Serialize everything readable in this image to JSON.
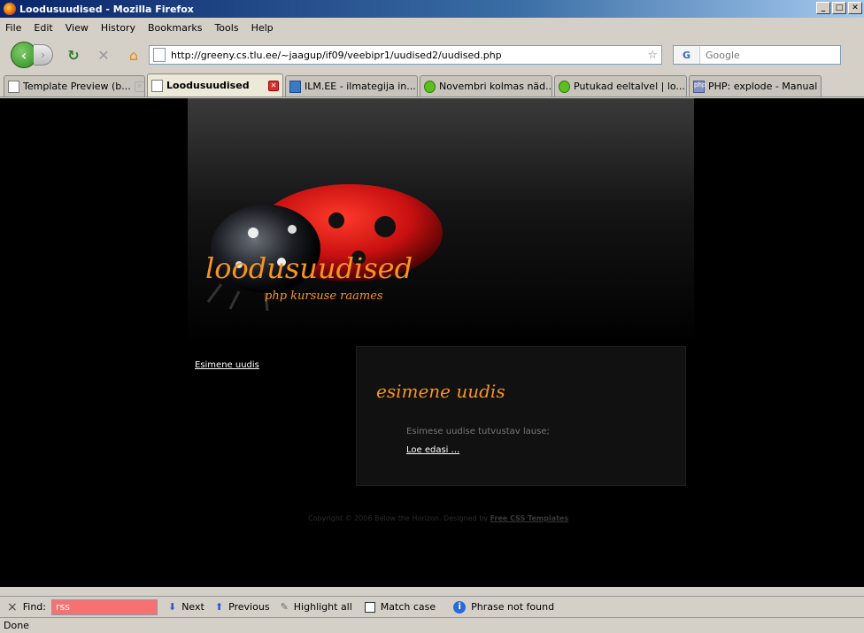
{
  "window": {
    "title": "Loodusuudised - Mozilla Firefox"
  },
  "menu": [
    "File",
    "Edit",
    "View",
    "History",
    "Bookmarks",
    "Tools",
    "Help"
  ],
  "nav": {
    "url": "http://greeny.cs.tlu.ee/~jaagup/if09/veebipr1/uudised2/uudised.php",
    "search_placeholder": "Google"
  },
  "tabs": [
    {
      "label": "Template Preview (b...",
      "icon": "page-icon"
    },
    {
      "label": "Loodusuudised",
      "icon": "page-icon",
      "active": true
    },
    {
      "label": "ILM.EE - ilmategija in...",
      "icon": "ilm-icon"
    },
    {
      "label": "Novembri kolmas näd...",
      "icon": "leaf-icon"
    },
    {
      "label": "Putukad eeltalvel | lo...",
      "icon": "leaf-icon"
    },
    {
      "label": "PHP: explode - Manual",
      "icon": "php-icon"
    }
  ],
  "page": {
    "site_title": "loodusuudised",
    "site_subtitle": "php kursuse raames",
    "sidebar_link": "Esimene uudis",
    "news": {
      "title": "esimene uudis",
      "text": "Esimese uudise tutvustav lause;",
      "read_more": "Loe edasi ..."
    },
    "copyright_text": "Copyright © 2006 Below the Horizon. Designed by",
    "copyright_link": "Free CSS Templates"
  },
  "find": {
    "close": "×",
    "label": "Find:",
    "value": "rss",
    "next": "Next",
    "previous": "Previous",
    "highlight": "Highlight all",
    "match_case": "Match case",
    "status": "Phrase not found"
  },
  "status": "Done",
  "colors": {
    "accent": "#f7941d",
    "find_error": "#f87171"
  }
}
